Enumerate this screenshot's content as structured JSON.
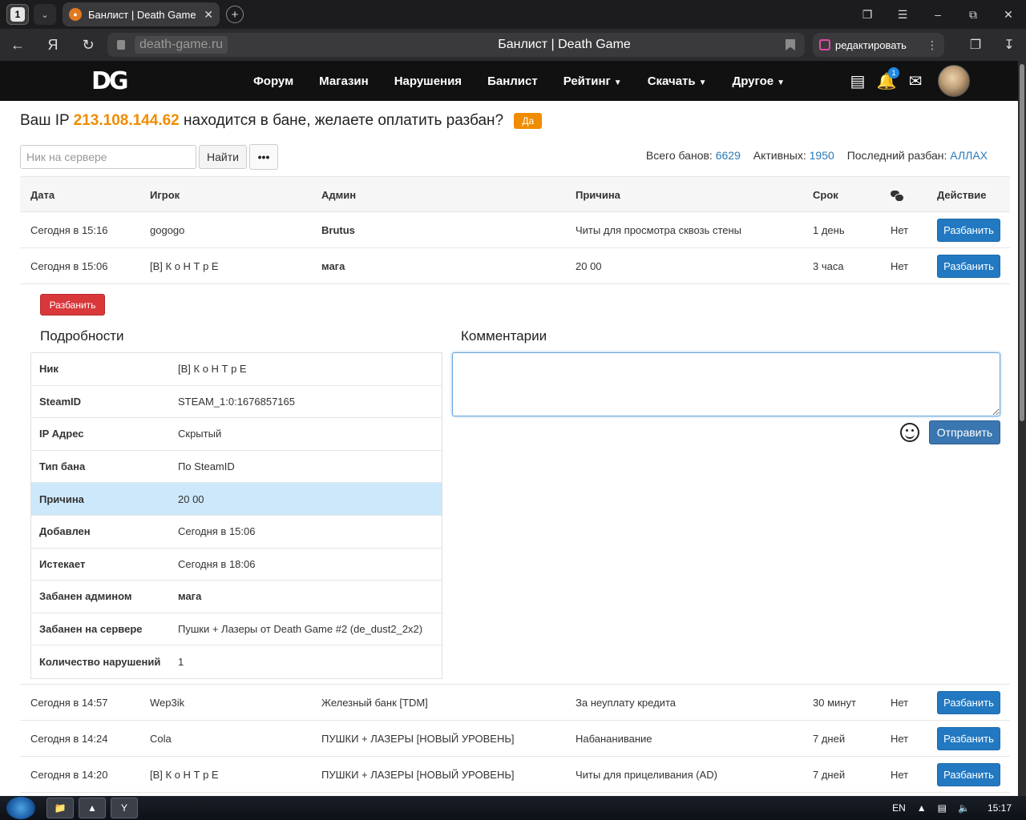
{
  "browser": {
    "tab_count": "1",
    "tab_title": "Банлист | Death Game",
    "url": "death-game.ru",
    "page_title": "Банлист | Death Game",
    "edit_label": "редактировать"
  },
  "header": {
    "logo": "DG",
    "nav": [
      {
        "label": "Форум"
      },
      {
        "label": "Магазин"
      },
      {
        "label": "Нарушения"
      },
      {
        "label": "Банлист"
      },
      {
        "label": "Рейтинг"
      },
      {
        "label": "Скачать"
      },
      {
        "label": "Другое"
      }
    ],
    "notification_count": "1"
  },
  "ban_notice": {
    "prefix": "Ваш IP",
    "ip": "213.108.144.62",
    "suffix": "находится в бане, желаете оплатить разбан?",
    "yes_label": "Да"
  },
  "search": {
    "placeholder": "Ник на сервере",
    "find_label": "Найти",
    "more_label": "•••"
  },
  "stats": {
    "total_label": "Всего банов:",
    "total": "6629",
    "active_label": "Активных:",
    "active": "1950",
    "last_label": "Последний разбан:",
    "last": "АЛЛАХ"
  },
  "table": {
    "headers": [
      "Дата",
      "Игрок",
      "Админ",
      "Причина",
      "Срок",
      "",
      "Действие"
    ],
    "unban_label": "Разбанить",
    "rows_top": [
      {
        "date": "Сегодня в 15:16",
        "player": "gogogo",
        "admin": "Brutus",
        "reason": "Читы для просмотра сквозь стены",
        "term": "1 день",
        "comments": "Нет"
      },
      {
        "date": "Сегодня в 15:06",
        "player": "[B] К о Н Т р Е",
        "admin": "мага",
        "reason": "20 00",
        "term": "3 часа",
        "comments": "Нет"
      }
    ],
    "rows_bottom": [
      {
        "date": "Сегодня в 14:57",
        "player": "Wep3ik",
        "admin": "Железный банк [TDM]",
        "reason": "За неуплату кредита",
        "term": "30 минут",
        "comments": "Нет"
      },
      {
        "date": "Сегодня в 14:24",
        "player": "Cola",
        "admin": "ПУШКИ + ЛАЗЕРЫ [НОВЫЙ УРОВЕНЬ]",
        "reason": "Набананивание",
        "term": "7 дней",
        "comments": "Нет"
      },
      {
        "date": "Сегодня в 14:20",
        "player": "[B] К о Н Т р Е",
        "admin": "ПУШКИ + ЛАЗЕРЫ [НОВЫЙ УРОВЕНЬ]",
        "reason": "Читы для прицеливания (AD)",
        "term": "7 дней",
        "comments": "Нет"
      }
    ]
  },
  "details": {
    "unban_label": "Разбанить",
    "title": "Подробности",
    "rows": [
      {
        "key": "Ник",
        "value": "[B] К о Н Т р Е"
      },
      {
        "key": "SteamID",
        "value": "STEAM_1:0:1676857165"
      },
      {
        "key": "IP Адрес",
        "value": "Скрытый"
      },
      {
        "key": "Тип бана",
        "value": "По SteamID"
      },
      {
        "key": "Причина",
        "value": "20 00"
      },
      {
        "key": "Добавлен",
        "value": "Сегодня в 15:06"
      },
      {
        "key": "Истекает",
        "value": "Сегодня в 18:06"
      },
      {
        "key": "Забанен админом",
        "value": "мага"
      },
      {
        "key": "Забанен на сервере",
        "value": "Пушки + Лазеры от Death Game #2 (de_dust2_2x2)"
      },
      {
        "key": "Количество нарушений",
        "value": "1"
      }
    ],
    "highlight_row": "Причина"
  },
  "comments": {
    "title": "Комментарии",
    "value": "",
    "send_label": "Отправить"
  },
  "taskbar": {
    "lang": "EN",
    "time": "15:17"
  }
}
